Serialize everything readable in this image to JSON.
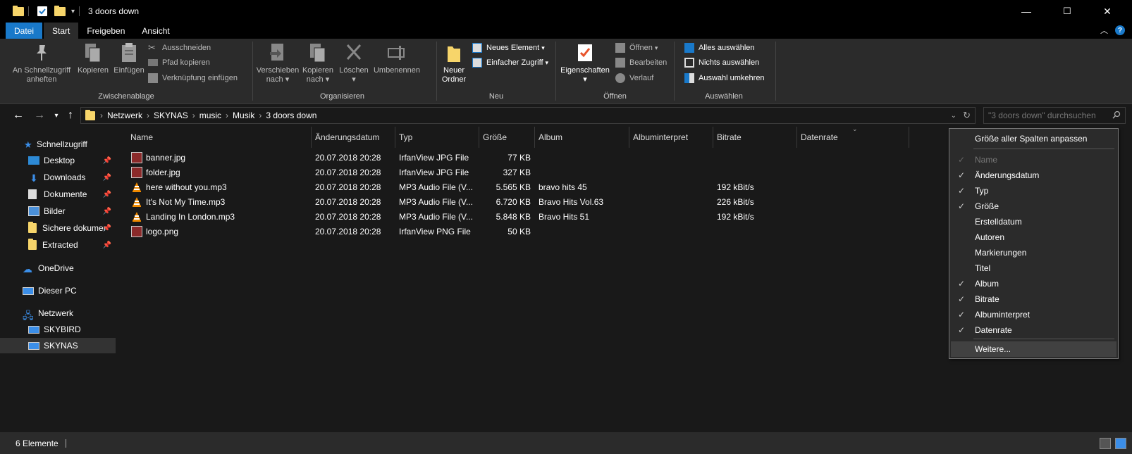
{
  "window": {
    "title": "3 doors down",
    "minimize_glyph": "—",
    "maximize_glyph": "☐",
    "close_glyph": "✕"
  },
  "ribbon_tabs": [
    "Datei",
    "Start",
    "Freigeben",
    "Ansicht"
  ],
  "ribbon": {
    "clipboard": {
      "pin_label_1": "An Schnellzugriff",
      "pin_label_2": "anheften",
      "copy": "Kopieren",
      "paste": "Einfügen",
      "cut": "Ausschneiden",
      "copy_path": "Pfad kopieren",
      "paste_shortcut": "Verknüpfung einfügen",
      "group_label": "Zwischenablage"
    },
    "organize": {
      "move_1": "Verschieben",
      "move_2": "nach",
      "copyto_1": "Kopieren",
      "copyto_2": "nach",
      "delete": "Löschen",
      "rename": "Umbenennen",
      "group_label": "Organisieren"
    },
    "new": {
      "new_folder_1": "Neuer",
      "new_folder_2": "Ordner",
      "new_item": "Neues Element",
      "easy_access": "Einfacher Zugriff",
      "group_label": "Neu"
    },
    "open": {
      "properties": "Eigenschaften",
      "open": "Öffnen",
      "edit": "Bearbeiten",
      "history": "Verlauf",
      "group_label": "Öffnen"
    },
    "select": {
      "select_all": "Alles auswählen",
      "select_none": "Nichts auswählen",
      "invert": "Auswahl umkehren",
      "group_label": "Auswählen"
    }
  },
  "address": {
    "crumbs": [
      "Netzwerk",
      "SKYNAS",
      "music",
      "Musik",
      "3 doors down"
    ],
    "search_placeholder": "\"3 doors down\" durchsuchen"
  },
  "nav_pane": {
    "quick_access": "Schnellzugriff",
    "items": [
      "Desktop",
      "Downloads",
      "Dokumente",
      "Bilder",
      "Sichere dokumer",
      "Extracted"
    ],
    "onedrive": "OneDrive",
    "this_pc": "Dieser PC",
    "network": "Netzwerk",
    "network_items": [
      "SKYBIRD",
      "SKYNAS"
    ]
  },
  "columns": [
    "Name",
    "Änderungsdatum",
    "Typ",
    "Größe",
    "Album",
    "Albuminterpret",
    "Bitrate",
    "Datenrate"
  ],
  "files": [
    {
      "name": "banner.jpg",
      "date": "20.07.2018 20:28",
      "type": "IrfanView JPG File",
      "size": "77 KB",
      "album": "",
      "bitrate": "",
      "icon": "image-icon"
    },
    {
      "name": "folder.jpg",
      "date": "20.07.2018 20:28",
      "type": "IrfanView JPG File",
      "size": "327 KB",
      "album": "",
      "bitrate": "",
      "icon": "image-icon"
    },
    {
      "name": "here without you.mp3",
      "date": "20.07.2018 20:28",
      "type": "MP3 Audio File (V...",
      "size": "5.565 KB",
      "album": "bravo hits 45",
      "bitrate": "192 kBit/s",
      "icon": "vlc-icon"
    },
    {
      "name": "It's Not My Time.mp3",
      "date": "20.07.2018 20:28",
      "type": "MP3 Audio File (V...",
      "size": "6.720 KB",
      "album": "Bravo Hits Vol.63",
      "bitrate": "226 kBit/s",
      "icon": "vlc-icon"
    },
    {
      "name": "Landing In London.mp3",
      "date": "20.07.2018 20:28",
      "type": "MP3 Audio File (V...",
      "size": "5.848 KB",
      "album": "Bravo Hits 51",
      "bitrate": "192 kBit/s",
      "icon": "vlc-icon"
    },
    {
      "name": "logo.png",
      "date": "20.07.2018 20:28",
      "type": "IrfanView PNG File",
      "size": "50 KB",
      "album": "",
      "bitrate": "",
      "icon": "image-icon"
    }
  ],
  "column_menu": {
    "fit_all": "Größe aller Spalten anpassen",
    "items": [
      {
        "label": "Name",
        "checked": true,
        "disabled": true
      },
      {
        "label": "Änderungsdatum",
        "checked": true,
        "disabled": false
      },
      {
        "label": "Typ",
        "checked": true,
        "disabled": false
      },
      {
        "label": "Größe",
        "checked": true,
        "disabled": false
      },
      {
        "label": "Erstelldatum",
        "checked": false,
        "disabled": false
      },
      {
        "label": "Autoren",
        "checked": false,
        "disabled": false
      },
      {
        "label": "Markierungen",
        "checked": false,
        "disabled": false
      },
      {
        "label": "Titel",
        "checked": false,
        "disabled": false
      },
      {
        "label": "Album",
        "checked": true,
        "disabled": false
      },
      {
        "label": "Bitrate",
        "checked": true,
        "disabled": false
      },
      {
        "label": "Albuminterpret",
        "checked": true,
        "disabled": false
      },
      {
        "label": "Datenrate",
        "checked": true,
        "disabled": false
      }
    ],
    "more": "Weitere..."
  },
  "status": {
    "count": "6 Elemente"
  },
  "colors": {
    "accent": "#1979ca",
    "folder": "#f7d56a"
  }
}
